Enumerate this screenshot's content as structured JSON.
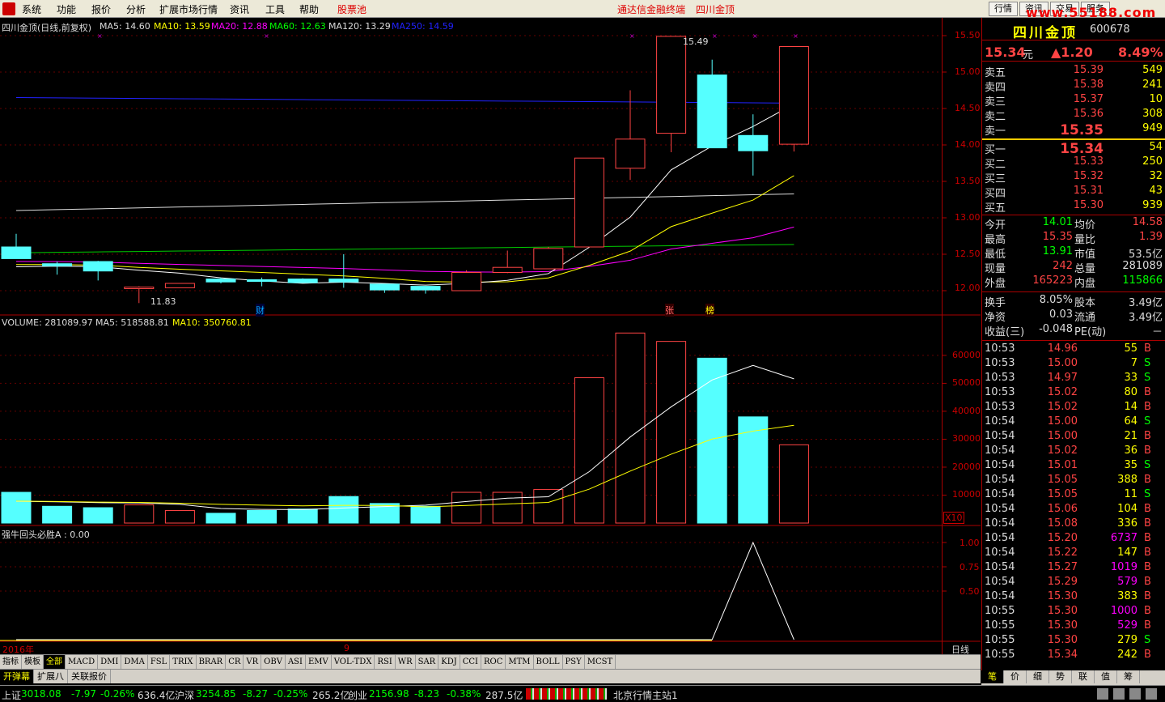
{
  "menu": {
    "items": [
      "系统",
      "功能",
      "报价",
      "分析",
      "扩展市场行情",
      "资讯",
      "工具",
      "帮助"
    ],
    "highlight": "股票池",
    "center1": "通达信金融终端",
    "center2": "四川金顶",
    "btns": [
      "行情",
      "资讯",
      "交易",
      "服务"
    ],
    "watermark": "www.55188.com"
  },
  "chart": {
    "title": "四川金顶(日线,前复权)",
    "ma5": "MA5: 14.60",
    "ma10": "MA10: 13.59",
    "ma20": "MA20: 12.88",
    "ma60": "MA60: 12.63",
    "ma120": "MA120: 13.29",
    "ma250": "MA250: 14.59",
    "high_mark": "15.49",
    "low_mark": "11.83",
    "markers": [
      "财",
      "张",
      "榜"
    ],
    "price_ticks": [
      "15.50",
      "15.00",
      "14.50",
      "14.00",
      "13.50",
      "13.00",
      "12.50",
      "12.00"
    ],
    "volume_line": "VOLUME: 281089.97",
    "vol_ma5": "MA5: 518588.81",
    "vol_ma10": "MA10: 350760.81",
    "vol_ticks": [
      "60000",
      "50000",
      "40000",
      "30000",
      "20000",
      "10000"
    ],
    "vol_unit": "X10",
    "ind_title": "强牛回头必胜A : 0.00",
    "ind_ticks": [
      "1.00",
      "0.75",
      "0.50"
    ],
    "date_left": "2016年",
    "date_mid": "9",
    "period": "日线"
  },
  "chart_data": {
    "type": "candlestick",
    "candles": [
      [
        12.6,
        12.44,
        12.78,
        12.44
      ],
      [
        12.37,
        12.34,
        12.4,
        12.22
      ],
      [
        12.4,
        12.27,
        12.41,
        12.14
      ],
      [
        12.05,
        12.05,
        12.06,
        11.83
      ],
      [
        12.04,
        12.1,
        12.1,
        12.04
      ],
      [
        12.16,
        12.12,
        12.18,
        12.1
      ],
      [
        12.15,
        12.13,
        12.18,
        12.06
      ],
      [
        12.16,
        12.11,
        12.17,
        12.11
      ],
      [
        12.16,
        12.12,
        12.5,
        12.04
      ],
      [
        12.09,
        12.01,
        12.09,
        11.97
      ],
      [
        12.06,
        12.01,
        12.06,
        11.96
      ],
      [
        12.0,
        12.25,
        12.28,
        12.0
      ],
      [
        12.25,
        12.32,
        12.55,
        12.24
      ],
      [
        12.3,
        12.58,
        12.6,
        12.3
      ],
      [
        12.6,
        13.82,
        13.82,
        12.6
      ],
      [
        13.68,
        14.08,
        14.75,
        13.52
      ],
      [
        14.16,
        15.49,
        15.49,
        13.9
      ],
      [
        14.96,
        13.96,
        15.17,
        13.96
      ],
      [
        14.13,
        13.92,
        14.42,
        13.58
      ],
      [
        14.01,
        15.35,
        15.35,
        13.91
      ]
    ],
    "volume": [
      11000,
      6000,
      5500,
      6500,
      4500,
      3500,
      4500,
      5000,
      9500,
      7000,
      6000,
      11000,
      11000,
      12000,
      52000,
      68000,
      65000,
      59000,
      38000,
      28000
    ],
    "indicator": [
      0,
      0,
      0,
      0,
      0,
      0,
      0,
      0,
      0,
      0,
      0,
      0,
      0,
      0,
      0,
      0,
      0,
      0,
      1,
      0
    ]
  },
  "quote": {
    "name": "四川金顶",
    "code": "600678",
    "price": "15.34",
    "unit": "元",
    "change": "▲1.20",
    "pct": "8.49%",
    "sells": [
      [
        "卖五",
        "15.39",
        "549"
      ],
      [
        "卖四",
        "15.38",
        "241"
      ],
      [
        "卖三",
        "15.37",
        "10"
      ],
      [
        "卖二",
        "15.36",
        "308"
      ],
      [
        "卖一",
        "15.35",
        "949"
      ]
    ],
    "buys": [
      [
        "买一",
        "15.34",
        "54"
      ],
      [
        "买二",
        "15.33",
        "250"
      ],
      [
        "买三",
        "15.32",
        "32"
      ],
      [
        "买四",
        "15.31",
        "43"
      ],
      [
        "买五",
        "15.30",
        "939"
      ]
    ],
    "stats": [
      [
        "今开",
        "14.01",
        "均价",
        "14.58"
      ],
      [
        "最高",
        "15.35",
        "量比",
        "1.39"
      ],
      [
        "最低",
        "13.91",
        "市值",
        "53.5亿"
      ],
      [
        "现量",
        "242",
        "总量",
        "281089"
      ],
      [
        "外盘",
        "165223",
        "内盘",
        "115866"
      ]
    ],
    "stats2": [
      [
        "换手",
        "8.05%",
        "股本",
        "3.49亿"
      ],
      [
        "净资",
        "0.03",
        "流通",
        "3.49亿"
      ],
      [
        "收益(三)",
        "-0.048",
        "PE(动)",
        "－"
      ]
    ],
    "ticks": [
      [
        "10:53",
        "14.96",
        "55",
        "B"
      ],
      [
        "10:53",
        "15.00",
        "7",
        "S"
      ],
      [
        "10:53",
        "14.97",
        "33",
        "S"
      ],
      [
        "10:53",
        "15.02",
        "80",
        "B"
      ],
      [
        "10:53",
        "15.02",
        "14",
        "B"
      ],
      [
        "10:54",
        "15.00",
        "64",
        "S"
      ],
      [
        "10:54",
        "15.00",
        "21",
        "B"
      ],
      [
        "10:54",
        "15.02",
        "36",
        "B"
      ],
      [
        "10:54",
        "15.01",
        "35",
        "S"
      ],
      [
        "10:54",
        "15.05",
        "388",
        "B"
      ],
      [
        "10:54",
        "15.05",
        "11",
        "S"
      ],
      [
        "10:54",
        "15.06",
        "104",
        "B"
      ],
      [
        "10:54",
        "15.08",
        "336",
        "B"
      ],
      [
        "10:54",
        "15.20",
        "6737",
        "B"
      ],
      [
        "10:54",
        "15.22",
        "147",
        "B"
      ],
      [
        "10:54",
        "15.27",
        "1019",
        "B"
      ],
      [
        "10:54",
        "15.29",
        "579",
        "B"
      ],
      [
        "10:54",
        "15.30",
        "383",
        "B"
      ],
      [
        "10:55",
        "15.30",
        "1000",
        "B"
      ],
      [
        "10:55",
        "15.30",
        "529",
        "B"
      ],
      [
        "10:55",
        "15.30",
        "279",
        "S"
      ],
      [
        "10:55",
        "15.34",
        "242",
        "B"
      ]
    ]
  },
  "tabs": [
    "指标",
    "模板",
    "全部",
    "MACD",
    "DMI",
    "DMA",
    "FSL",
    "TRIX",
    "BRAR",
    "CR",
    "VR",
    "OBV",
    "ASI",
    "EMV",
    "VOL-TDX",
    "RSI",
    "WR",
    "SAR",
    "KDJ",
    "CCI",
    "ROC",
    "MTM",
    "BOLL",
    "PSY",
    "MCST"
  ],
  "tabs2": [
    "开弹幕",
    "扩展八",
    "关联报价"
  ],
  "rtabs": [
    "笔",
    "价",
    "细",
    "势",
    "联",
    "值",
    "筹"
  ],
  "status": {
    "sh_name": "上证",
    "sh": "3018.08",
    "sh_chg": "-7.97",
    "sh_pct": "-0.26%",
    "sh_amt": "636.4亿",
    "sz_name": "沪深",
    "sz": "3254.85",
    "sz_chg": "-8.27",
    "sz_pct": "-0.25%",
    "sz_amt": "265.2亿",
    "cy_name": "创业",
    "cy": "2156.98",
    "cy_chg": "-8.23",
    "cy_pct": "-0.38%",
    "cy_amt": "287.5亿",
    "station": "北京行情主站1"
  }
}
